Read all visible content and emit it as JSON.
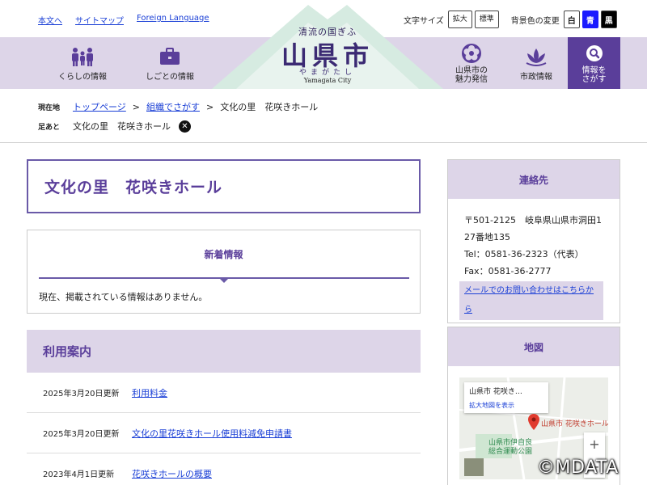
{
  "utility": {
    "links": [
      "本文へ",
      "サイトマップ",
      "Foreign Language"
    ],
    "font_size_label": "文字サイズ",
    "font_size_buttons": [
      "拡大",
      "標準"
    ],
    "bg_label": "背景色の変更",
    "bg_buttons": [
      "白",
      "青",
      "黒"
    ]
  },
  "logo": {
    "top": "清流の国ぎふ",
    "main": "山県市",
    "kana": "やまがたし",
    "en": "Yamagata City"
  },
  "nav": {
    "kurashi": "くらしの情報",
    "shigoto": "しごとの情報",
    "miryoku_1": "山県市の",
    "miryoku_2": "魅力発信",
    "shisei": "市政情報",
    "search_1": "情報を",
    "search_2": "さがす"
  },
  "breadcrumb": {
    "current_label": "現在地",
    "items": [
      "トップページ",
      "組織でさがす",
      "文化の里　花咲きホール"
    ],
    "history_label": "足あと",
    "history_item": "文化の里　花咲きホール"
  },
  "page_title": "文化の里　花咲きホール",
  "news": {
    "heading": "新着情報",
    "empty_text": "現在、掲載されている情報はありません。"
  },
  "usage": {
    "heading": "利用案内",
    "rows": [
      {
        "date": "2025年3月20日更新",
        "title": "利用料金"
      },
      {
        "date": "2025年3月20日更新",
        "title": "文化の里花咲きホール使用料減免申請書"
      },
      {
        "date": "2023年4月1日更新",
        "title": "花咲きホールの概要"
      }
    ]
  },
  "contact": {
    "heading": "連絡先",
    "address_1": "〒501-2125　岐阜県山県市洞田1",
    "address_2": "27番地135",
    "tel": "Tel：0581-36-2323（代表）",
    "fax": "Fax：0581-36-2777",
    "mail_link": "メールでのお問い合わせはこちらから"
  },
  "map": {
    "heading": "地図",
    "card_title": "山県市 花咲き…",
    "card_link": "拡大地図を表示",
    "pin_label": "山県市 花咲きホール",
    "park_1": "山県市伊自良",
    "park_2": "総合運動公園",
    "zoom_in": "+",
    "zoom_out": "−"
  },
  "copyright": "©MDATA",
  "colors": {
    "accent": "#5a3e9a",
    "band": "#ddd5e8"
  }
}
